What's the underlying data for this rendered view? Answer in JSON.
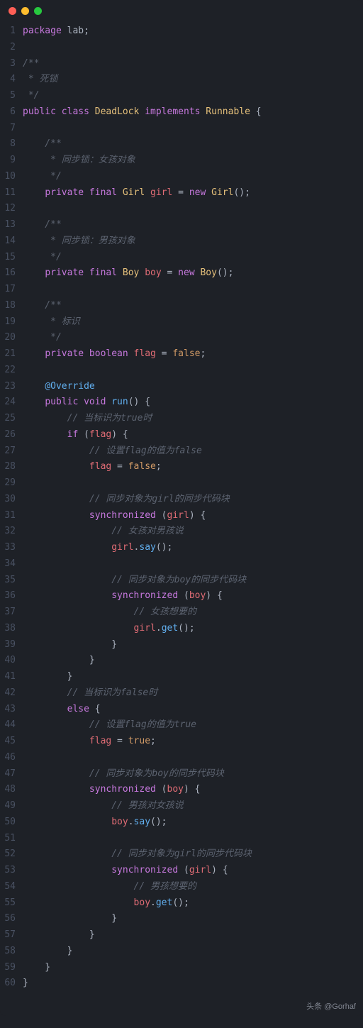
{
  "footer": "头条 @Gorhaf",
  "code": [
    {
      "n": 1,
      "t": [
        {
          "c": "kw",
          "s": "package"
        },
        {
          "c": "pkg",
          "s": " lab"
        },
        {
          "c": "punc",
          "s": ";"
        }
      ]
    },
    {
      "n": 2,
      "t": []
    },
    {
      "n": 3,
      "t": [
        {
          "c": "cmt",
          "s": "/**"
        }
      ]
    },
    {
      "n": 4,
      "t": [
        {
          "c": "cmt",
          "s": " * 死锁"
        }
      ]
    },
    {
      "n": 5,
      "t": [
        {
          "c": "cmt",
          "s": " */"
        }
      ]
    },
    {
      "n": 6,
      "t": [
        {
          "c": "kw",
          "s": "public class"
        },
        {
          "c": "cls",
          "s": " DeadLock "
        },
        {
          "c": "kw",
          "s": "implements"
        },
        {
          "c": "cls",
          "s": " Runnable "
        },
        {
          "c": "punc",
          "s": "{"
        }
      ]
    },
    {
      "n": 7,
      "t": []
    },
    {
      "n": 8,
      "t": [
        {
          "c": "cmt",
          "s": "    /**"
        }
      ]
    },
    {
      "n": 9,
      "t": [
        {
          "c": "cmt",
          "s": "     * 同步锁：女孩对象"
        }
      ]
    },
    {
      "n": 10,
      "t": [
        {
          "c": "cmt",
          "s": "     */"
        }
      ]
    },
    {
      "n": 11,
      "t": [
        {
          "c": "op",
          "s": "    "
        },
        {
          "c": "kw",
          "s": "private final"
        },
        {
          "c": "cls",
          "s": " Girl "
        },
        {
          "c": "var",
          "s": "girl"
        },
        {
          "c": "op",
          "s": " = "
        },
        {
          "c": "kw",
          "s": "new"
        },
        {
          "c": "cls",
          "s": " Girl"
        },
        {
          "c": "punc",
          "s": "();"
        }
      ]
    },
    {
      "n": 12,
      "t": []
    },
    {
      "n": 13,
      "t": [
        {
          "c": "cmt",
          "s": "    /**"
        }
      ]
    },
    {
      "n": 14,
      "t": [
        {
          "c": "cmt",
          "s": "     * 同步锁：男孩对象"
        }
      ]
    },
    {
      "n": 15,
      "t": [
        {
          "c": "cmt",
          "s": "     */"
        }
      ]
    },
    {
      "n": 16,
      "t": [
        {
          "c": "op",
          "s": "    "
        },
        {
          "c": "kw",
          "s": "private final"
        },
        {
          "c": "cls",
          "s": " Boy "
        },
        {
          "c": "var",
          "s": "boy"
        },
        {
          "c": "op",
          "s": " = "
        },
        {
          "c": "kw",
          "s": "new"
        },
        {
          "c": "cls",
          "s": " Boy"
        },
        {
          "c": "punc",
          "s": "();"
        }
      ]
    },
    {
      "n": 17,
      "t": []
    },
    {
      "n": 18,
      "t": [
        {
          "c": "cmt",
          "s": "    /**"
        }
      ]
    },
    {
      "n": 19,
      "t": [
        {
          "c": "cmt",
          "s": "     * 标识"
        }
      ]
    },
    {
      "n": 20,
      "t": [
        {
          "c": "cmt",
          "s": "     */"
        }
      ]
    },
    {
      "n": 21,
      "t": [
        {
          "c": "op",
          "s": "    "
        },
        {
          "c": "kw",
          "s": "private boolean"
        },
        {
          "c": "var",
          "s": " flag"
        },
        {
          "c": "op",
          "s": " = "
        },
        {
          "c": "bool",
          "s": "false"
        },
        {
          "c": "punc",
          "s": ";"
        }
      ]
    },
    {
      "n": 22,
      "t": []
    },
    {
      "n": 23,
      "t": [
        {
          "c": "op",
          "s": "    "
        },
        {
          "c": "at",
          "s": "@Override"
        }
      ]
    },
    {
      "n": 24,
      "t": [
        {
          "c": "op",
          "s": "    "
        },
        {
          "c": "kw",
          "s": "public void"
        },
        {
          "c": "fn",
          "s": " run"
        },
        {
          "c": "punc",
          "s": "() {"
        }
      ]
    },
    {
      "n": 25,
      "t": [
        {
          "c": "cmt",
          "s": "        // 当标识为true时"
        }
      ]
    },
    {
      "n": 26,
      "t": [
        {
          "c": "op",
          "s": "        "
        },
        {
          "c": "kw",
          "s": "if"
        },
        {
          "c": "punc",
          "s": " ("
        },
        {
          "c": "var",
          "s": "flag"
        },
        {
          "c": "punc",
          "s": ") {"
        }
      ]
    },
    {
      "n": 27,
      "t": [
        {
          "c": "cmt",
          "s": "            // 设置flag的值为false"
        }
      ]
    },
    {
      "n": 28,
      "t": [
        {
          "c": "op",
          "s": "            "
        },
        {
          "c": "var",
          "s": "flag"
        },
        {
          "c": "op",
          "s": " = "
        },
        {
          "c": "bool",
          "s": "false"
        },
        {
          "c": "punc",
          "s": ";"
        }
      ]
    },
    {
      "n": 29,
      "t": []
    },
    {
      "n": 30,
      "t": [
        {
          "c": "cmt",
          "s": "            // 同步对象为girl的同步代码块"
        }
      ]
    },
    {
      "n": 31,
      "t": [
        {
          "c": "op",
          "s": "            "
        },
        {
          "c": "kw",
          "s": "synchronized"
        },
        {
          "c": "punc",
          "s": " ("
        },
        {
          "c": "var",
          "s": "girl"
        },
        {
          "c": "punc",
          "s": ") {"
        }
      ]
    },
    {
      "n": 32,
      "t": [
        {
          "c": "cmt",
          "s": "                // 女孩对男孩说"
        }
      ]
    },
    {
      "n": 33,
      "t": [
        {
          "c": "op",
          "s": "                "
        },
        {
          "c": "var",
          "s": "girl"
        },
        {
          "c": "punc",
          "s": "."
        },
        {
          "c": "fn",
          "s": "say"
        },
        {
          "c": "punc",
          "s": "();"
        }
      ]
    },
    {
      "n": 34,
      "t": []
    },
    {
      "n": 35,
      "t": [
        {
          "c": "cmt",
          "s": "                // 同步对象为boy的同步代码块"
        }
      ]
    },
    {
      "n": 36,
      "t": [
        {
          "c": "op",
          "s": "                "
        },
        {
          "c": "kw",
          "s": "synchronized"
        },
        {
          "c": "punc",
          "s": " ("
        },
        {
          "c": "var",
          "s": "boy"
        },
        {
          "c": "punc",
          "s": ") {"
        }
      ]
    },
    {
      "n": 37,
      "t": [
        {
          "c": "cmt",
          "s": "                    // 女孩想要的"
        }
      ]
    },
    {
      "n": 38,
      "t": [
        {
          "c": "op",
          "s": "                    "
        },
        {
          "c": "var",
          "s": "girl"
        },
        {
          "c": "punc",
          "s": "."
        },
        {
          "c": "fn",
          "s": "get"
        },
        {
          "c": "punc",
          "s": "();"
        }
      ]
    },
    {
      "n": 39,
      "t": [
        {
          "c": "punc",
          "s": "                }"
        }
      ]
    },
    {
      "n": 40,
      "t": [
        {
          "c": "punc",
          "s": "            }"
        }
      ]
    },
    {
      "n": 41,
      "t": [
        {
          "c": "punc",
          "s": "        }"
        }
      ]
    },
    {
      "n": 42,
      "t": [
        {
          "c": "cmt",
          "s": "        // 当标识为false时"
        }
      ]
    },
    {
      "n": 43,
      "t": [
        {
          "c": "op",
          "s": "        "
        },
        {
          "c": "kw",
          "s": "else"
        },
        {
          "c": "punc",
          "s": " {"
        }
      ]
    },
    {
      "n": 44,
      "t": [
        {
          "c": "cmt",
          "s": "            // 设置flag的值为true"
        }
      ]
    },
    {
      "n": 45,
      "t": [
        {
          "c": "op",
          "s": "            "
        },
        {
          "c": "var",
          "s": "flag"
        },
        {
          "c": "op",
          "s": " = "
        },
        {
          "c": "bool",
          "s": "true"
        },
        {
          "c": "punc",
          "s": ";"
        }
      ]
    },
    {
      "n": 46,
      "t": []
    },
    {
      "n": 47,
      "t": [
        {
          "c": "cmt",
          "s": "            // 同步对象为boy的同步代码块"
        }
      ]
    },
    {
      "n": 48,
      "t": [
        {
          "c": "op",
          "s": "            "
        },
        {
          "c": "kw",
          "s": "synchronized"
        },
        {
          "c": "punc",
          "s": " ("
        },
        {
          "c": "var",
          "s": "boy"
        },
        {
          "c": "punc",
          "s": ") {"
        }
      ]
    },
    {
      "n": 49,
      "t": [
        {
          "c": "cmt",
          "s": "                // 男孩对女孩说"
        }
      ]
    },
    {
      "n": 50,
      "t": [
        {
          "c": "op",
          "s": "                "
        },
        {
          "c": "var",
          "s": "boy"
        },
        {
          "c": "punc",
          "s": "."
        },
        {
          "c": "fn",
          "s": "say"
        },
        {
          "c": "punc",
          "s": "();"
        }
      ]
    },
    {
      "n": 51,
      "t": []
    },
    {
      "n": 52,
      "t": [
        {
          "c": "cmt",
          "s": "                // 同步对象为girl的同步代码块"
        }
      ]
    },
    {
      "n": 53,
      "t": [
        {
          "c": "op",
          "s": "                "
        },
        {
          "c": "kw",
          "s": "synchronized"
        },
        {
          "c": "punc",
          "s": " ("
        },
        {
          "c": "var",
          "s": "girl"
        },
        {
          "c": "punc",
          "s": ") {"
        }
      ]
    },
    {
      "n": 54,
      "t": [
        {
          "c": "cmt",
          "s": "                    // 男孩想要的"
        }
      ]
    },
    {
      "n": 55,
      "t": [
        {
          "c": "op",
          "s": "                    "
        },
        {
          "c": "var",
          "s": "boy"
        },
        {
          "c": "punc",
          "s": "."
        },
        {
          "c": "fn",
          "s": "get"
        },
        {
          "c": "punc",
          "s": "();"
        }
      ]
    },
    {
      "n": 56,
      "t": [
        {
          "c": "punc",
          "s": "                }"
        }
      ]
    },
    {
      "n": 57,
      "t": [
        {
          "c": "punc",
          "s": "            }"
        }
      ]
    },
    {
      "n": 58,
      "t": [
        {
          "c": "punc",
          "s": "        }"
        }
      ]
    },
    {
      "n": 59,
      "t": [
        {
          "c": "punc",
          "s": "    }"
        }
      ]
    },
    {
      "n": 60,
      "t": [
        {
          "c": "punc",
          "s": "}"
        }
      ]
    }
  ]
}
